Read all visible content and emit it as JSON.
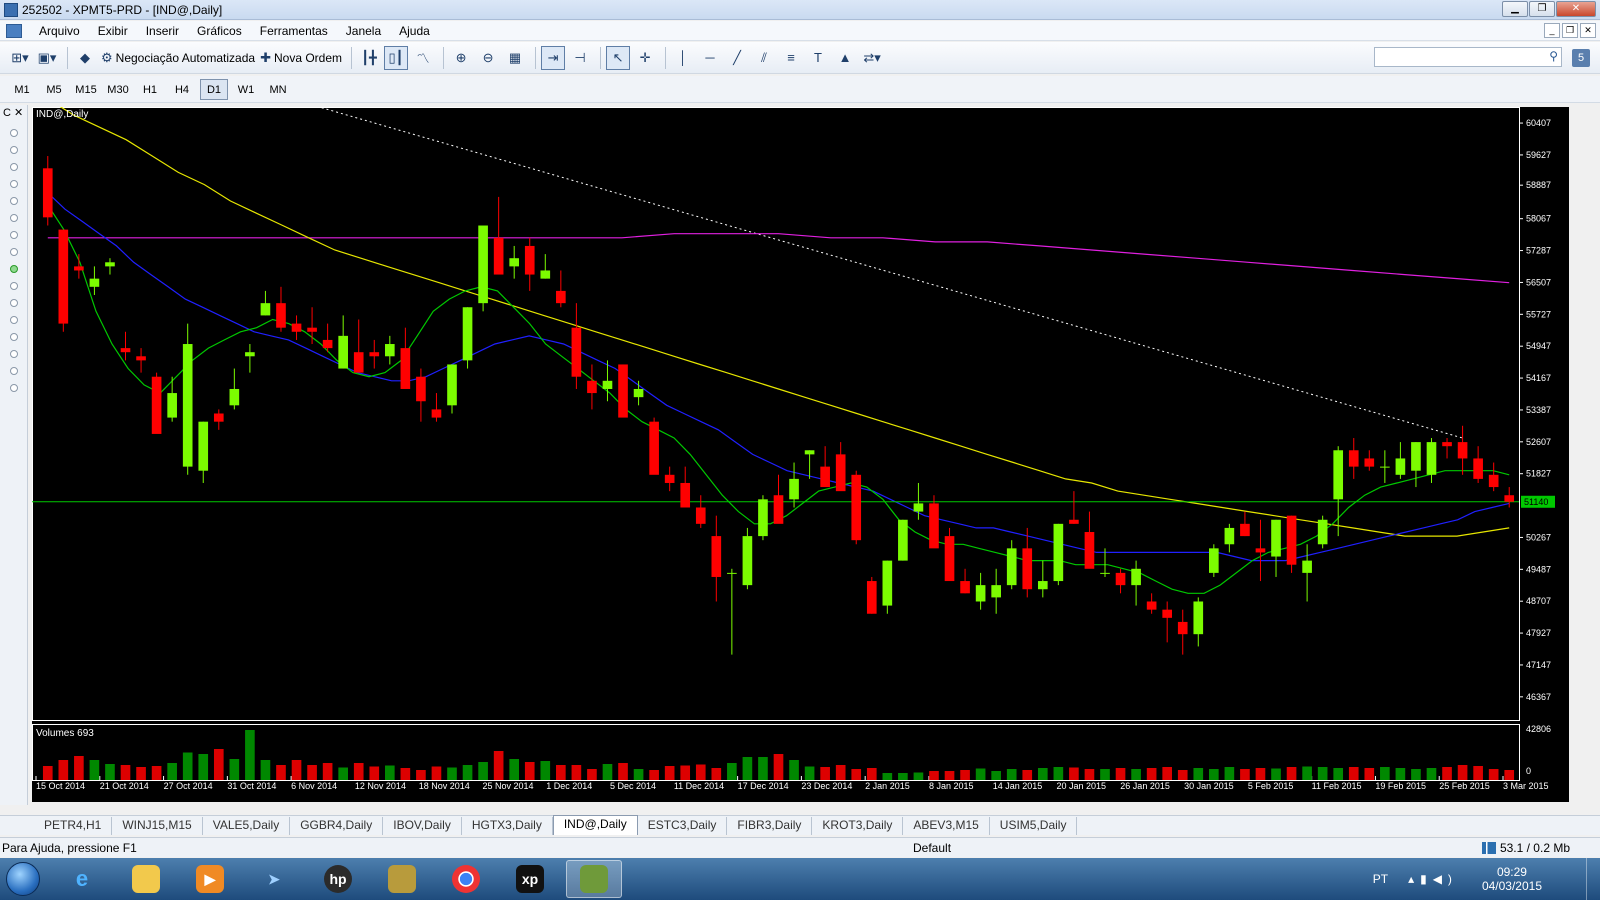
{
  "window": {
    "title": "252502 - XPMT5-PRD - [IND@,Daily]"
  },
  "menu": [
    "Arquivo",
    "Exibir",
    "Inserir",
    "Gráficos",
    "Ferramentas",
    "Janela",
    "Ajuda"
  ],
  "toolbar": {
    "auto_trading": "Negociação Automatizada",
    "new_order": "Nova Ordem",
    "search_badge": "5"
  },
  "timeframes": [
    "M1",
    "M5",
    "M15",
    "M30",
    "H1",
    "H4",
    "D1",
    "W1",
    "MN"
  ],
  "active_timeframe": "D1",
  "left_panel_label": "C",
  "chart": {
    "label": "IND@,Daily",
    "volumes_label": "Volumes 693",
    "last_price": "51140",
    "volume_axis": [
      "42806",
      "0"
    ],
    "colors": {
      "bull": "#7cfc00",
      "bear": "#ff0000",
      "ma_fast": "#00c800",
      "ma_mid": "#2020ff",
      "ma_slow": "#e6e600",
      "ma_long": "#e020e0",
      "hline": "#00c800",
      "trendline": "#ffffff"
    }
  },
  "chart_data": {
    "type": "candlestick",
    "y_ticks": [
      60407,
      59627,
      58887,
      58067,
      57287,
      56507,
      55727,
      54947,
      54167,
      53387,
      52607,
      51827,
      51140,
      50267,
      49487,
      48707,
      47927,
      47147,
      46367
    ],
    "x_labels": [
      "15 Oct 2014",
      "21 Oct 2014",
      "27 Oct 2014",
      "31 Oct 2014",
      "6 Nov 2014",
      "12 Nov 2014",
      "18 Nov 2014",
      "25 Nov 2014",
      "1 Dec 2014",
      "5 Dec 2014",
      "11 Dec 2014",
      "17 Dec 2014",
      "23 Dec 2014",
      "2 Jan 2015",
      "8 Jan 2015",
      "14 Jan 2015",
      "20 Jan 2015",
      "26 Jan 2015",
      "30 Jan 2015",
      "5 Feb 2015",
      "11 Feb 2015",
      "19 Feb 2015",
      "25 Feb 2015",
      "3 Mar 2015"
    ],
    "ylim": [
      45800,
      60800
    ],
    "candles": [
      [
        59300,
        59600,
        57900,
        58100
      ],
      [
        57800,
        57800,
        55300,
        55500
      ],
      [
        56900,
        57200,
        56600,
        56800
      ],
      [
        56400,
        56900,
        56200,
        56600
      ],
      [
        56900,
        57100,
        56700,
        57000
      ],
      [
        54900,
        55300,
        54600,
        54800
      ],
      [
        54700,
        54900,
        54300,
        54600
      ],
      [
        54200,
        54300,
        53200,
        52800
      ],
      [
        53200,
        54200,
        53100,
        53800
      ],
      [
        52000,
        55500,
        51800,
        55000
      ],
      [
        51900,
        53100,
        51600,
        53100
      ],
      [
        53300,
        53400,
        52900,
        53100
      ],
      [
        53500,
        54400,
        53400,
        53900
      ],
      [
        54700,
        55000,
        54300,
        54800
      ],
      [
        55700,
        56300,
        55700,
        56000
      ],
      [
        56000,
        56400,
        55300,
        55400
      ],
      [
        55500,
        55700,
        55100,
        55300
      ],
      [
        55400,
        55900,
        55000,
        55300
      ],
      [
        55100,
        55500,
        54800,
        54900
      ],
      [
        54400,
        55700,
        54400,
        55200
      ],
      [
        54800,
        55600,
        54400,
        54300
      ],
      [
        54800,
        55100,
        54400,
        54700
      ],
      [
        54700,
        55200,
        54500,
        55000
      ],
      [
        54900,
        55400,
        54400,
        53900
      ],
      [
        54200,
        54400,
        53100,
        53600
      ],
      [
        53400,
        53800,
        53100,
        53200
      ],
      [
        53500,
        54500,
        53300,
        54500
      ],
      [
        54600,
        55900,
        54400,
        55900
      ],
      [
        56000,
        57800,
        55800,
        57900
      ],
      [
        57600,
        58600,
        57000,
        56700
      ],
      [
        56900,
        57400,
        56600,
        57100
      ],
      [
        57400,
        57600,
        56300,
        56700
      ],
      [
        56600,
        57200,
        56600,
        56800
      ],
      [
        56300,
        56800,
        55900,
        56000
      ],
      [
        55400,
        56000,
        53900,
        54200
      ],
      [
        54100,
        54500,
        53400,
        53800
      ],
      [
        53900,
        54600,
        53600,
        54100
      ],
      [
        54500,
        54500,
        53400,
        53200
      ],
      [
        53700,
        54100,
        53500,
        53900
      ],
      [
        53100,
        53200,
        52000,
        51800
      ],
      [
        51800,
        52000,
        51400,
        51600
      ],
      [
        51600,
        52000,
        51300,
        51000
      ],
      [
        51000,
        51300,
        50500,
        50600
      ],
      [
        50300,
        50800,
        48700,
        49300
      ],
      [
        49400,
        49500,
        47400,
        49400
      ],
      [
        49100,
        50500,
        49000,
        50300
      ],
      [
        50300,
        51300,
        50200,
        51200
      ],
      [
        51300,
        51800,
        50700,
        50600
      ],
      [
        51200,
        52100,
        51000,
        51700
      ],
      [
        52300,
        52400,
        51700,
        52400
      ],
      [
        52000,
        52500,
        51800,
        51500
      ],
      [
        52300,
        52600,
        51600,
        51400
      ],
      [
        51800,
        51900,
        50100,
        50200
      ],
      [
        49200,
        49300,
        48400,
        48400
      ],
      [
        48600,
        49700,
        48400,
        49700
      ],
      [
        49700,
        50700,
        49700,
        50700
      ],
      [
        50900,
        51600,
        50700,
        51100
      ],
      [
        51100,
        51300,
        50400,
        50000
      ],
      [
        50300,
        50500,
        49300,
        49200
      ],
      [
        49200,
        49500,
        48900,
        48900
      ],
      [
        48700,
        49400,
        48500,
        49100
      ],
      [
        48800,
        49500,
        48400,
        49100
      ],
      [
        49100,
        50200,
        49000,
        50000
      ],
      [
        50000,
        50500,
        48800,
        49000
      ],
      [
        49000,
        49700,
        48800,
        49200
      ],
      [
        49200,
        50600,
        49100,
        50600
      ],
      [
        50700,
        51400,
        50600,
        50600
      ],
      [
        50400,
        50900,
        50100,
        49500
      ],
      [
        49400,
        50000,
        49300,
        49400
      ],
      [
        49400,
        49500,
        48900,
        49100
      ],
      [
        49100,
        49700,
        48600,
        49500
      ],
      [
        48700,
        48900,
        48400,
        48500
      ],
      [
        48500,
        48700,
        47700,
        48300
      ],
      [
        48200,
        48500,
        47400,
        47900
      ],
      [
        47900,
        48800,
        47600,
        48700
      ],
      [
        49400,
        50100,
        49300,
        50000
      ],
      [
        50100,
        50600,
        49900,
        50500
      ],
      [
        50600,
        50900,
        50300,
        50300
      ],
      [
        50000,
        50700,
        49200,
        49900
      ],
      [
        49800,
        50700,
        49300,
        50700
      ],
      [
        50800,
        50800,
        49400,
        49600
      ],
      [
        49400,
        50100,
        48700,
        49700
      ],
      [
        50100,
        50800,
        50000,
        50700
      ],
      [
        51200,
        52500,
        50300,
        52400
      ],
      [
        52400,
        52700,
        51700,
        52000
      ],
      [
        52200,
        52400,
        51900,
        52000
      ],
      [
        52000,
        52400,
        51600,
        52000
      ],
      [
        51800,
        52600,
        51700,
        52200
      ],
      [
        51900,
        52600,
        51500,
        52600
      ],
      [
        51800,
        52700,
        51600,
        52600
      ],
      [
        52600,
        52700,
        52200,
        52500
      ],
      [
        52600,
        53000,
        51800,
        52200
      ],
      [
        52200,
        52500,
        51600,
        51700
      ],
      [
        51800,
        52100,
        51400,
        51500
      ],
      [
        51300,
        51500,
        51000,
        51140
      ]
    ],
    "volumes": [
      0.28,
      0.4,
      0.48,
      0.4,
      0.32,
      0.3,
      0.26,
      0.28,
      0.34,
      0.55,
      0.52,
      0.62,
      0.42,
      1.0,
      0.4,
      0.3,
      0.4,
      0.3,
      0.34,
      0.25,
      0.34,
      0.27,
      0.29,
      0.24,
      0.2,
      0.27,
      0.25,
      0.3,
      0.36,
      0.58,
      0.42,
      0.36,
      0.38,
      0.3,
      0.3,
      0.22,
      0.32,
      0.34,
      0.22,
      0.2,
      0.28,
      0.29,
      0.31,
      0.24,
      0.34,
      0.46,
      0.46,
      0.52,
      0.4,
      0.27,
      0.26,
      0.3,
      0.22,
      0.24,
      0.14,
      0.14,
      0.15,
      0.18,
      0.18,
      0.2,
      0.23,
      0.18,
      0.22,
      0.2,
      0.24,
      0.26,
      0.25,
      0.22,
      0.22,
      0.24,
      0.22,
      0.24,
      0.26,
      0.2,
      0.24,
      0.22,
      0.26,
      0.22,
      0.24,
      0.23,
      0.26,
      0.27,
      0.26,
      0.24,
      0.26,
      0.24,
      0.26,
      0.24,
      0.22,
      0.24,
      0.26,
      0.3,
      0.28,
      0.22,
      0.2,
      0.16
    ],
    "ma_fast": [
      58400,
      57800,
      57000,
      55800,
      55000,
      54400,
      54000,
      53800,
      54200,
      54600,
      54900,
      55100,
      55300,
      55400,
      55600,
      55500,
      55300,
      55000,
      54600,
      54300,
      54200,
      54300,
      54600,
      55200,
      55800,
      56100,
      56300,
      56400,
      56300,
      55900,
      55500,
      55000,
      54700,
      54400,
      54100,
      53800,
      53400,
      53100,
      52900,
      52700,
      52300,
      51800,
      51300,
      50900,
      50600,
      50600,
      50800,
      51100,
      51400,
      51500,
      51600,
      51500,
      51200,
      50700,
      50400,
      50200,
      50100,
      50100,
      50000,
      49900,
      49800,
      49700,
      49700,
      49700,
      49600,
      49600,
      49600,
      49500,
      49400,
      49200,
      49000,
      48900,
      48900,
      49100,
      49400,
      49700,
      49900,
      50000,
      50100,
      50300,
      50600,
      51000,
      51300,
      51500,
      51600,
      51700,
      51800,
      51900,
      51900,
      51900,
      51900,
      51800
    ],
    "ma_mid": [
      58700,
      58300,
      58000,
      57700,
      57400,
      57000,
      56700,
      56400,
      56100,
      55900,
      55700,
      55500,
      55300,
      55200,
      55100,
      54900,
      54700,
      54500,
      54300,
      54200,
      54100,
      54100,
      54200,
      54400,
      54600,
      54800,
      55000,
      55100,
      55200,
      55100,
      55000,
      54800,
      54600,
      54400,
      54100,
      53800,
      53500,
      53300,
      53100,
      52900,
      52600,
      52300,
      52100,
      51900,
      51800,
      51700,
      51600,
      51500,
      51400,
      51200,
      51000,
      50800,
      50700,
      50600,
      50500,
      50500,
      50400,
      50300,
      50200,
      50100,
      50000,
      49900,
      49900,
      49900,
      49900,
      49900,
      49900,
      49900,
      49900,
      49800,
      49700,
      49700,
      49700,
      49800,
      49900,
      50000,
      50100,
      50200,
      50300,
      50400,
      50500,
      50600,
      50700,
      50900,
      51000,
      51100
    ],
    "ma_slow": [
      61000,
      60600,
      60300,
      60000,
      59600,
      59200,
      58900,
      58500,
      58200,
      57900,
      57600,
      57300,
      57100,
      56900,
      56700,
      56500,
      56300,
      56100,
      55900,
      55700,
      55500,
      55300,
      55100,
      54900,
      54700,
      54500,
      54300,
      54100,
      53900,
      53700,
      53500,
      53300,
      53100,
      52900,
      52700,
      52500,
      52300,
      52100,
      51900,
      51700,
      51600,
      51400,
      51300,
      51200,
      51100,
      51000,
      50900,
      50800,
      50700,
      50600,
      50500,
      50400,
      50300,
      50300,
      50300,
      50400,
      50500
    ],
    "ma_long": [
      57600,
      57600,
      57600,
      57600,
      57600,
      57600,
      57600,
      57600,
      57600,
      57600,
      57600,
      57600,
      57700,
      57700,
      57700,
      57600,
      57600,
      57500,
      57500,
      57400,
      57300,
      57200,
      57100,
      57000,
      56900,
      56800,
      56700,
      56600,
      56500
    ]
  },
  "tabs": [
    "PETR4,H1",
    "WINJ15,M15",
    "VALE5,Daily",
    "GGBR4,Daily",
    "IBOV,Daily",
    "HGTX3,Daily",
    "IND@,Daily",
    "ESTC3,Daily",
    "FIBR3,Daily",
    "KROT3,Daily",
    "ABEV3,M15",
    "USIM5,Daily"
  ],
  "active_tab": "IND@,Daily",
  "status": {
    "help": "Para Ajuda, pressione F1",
    "profile": "Default",
    "traffic": "53.1 / 0.2 Mb"
  },
  "taskbar": {
    "lang": "PT",
    "time": "09:29",
    "date": "04/03/2015"
  }
}
